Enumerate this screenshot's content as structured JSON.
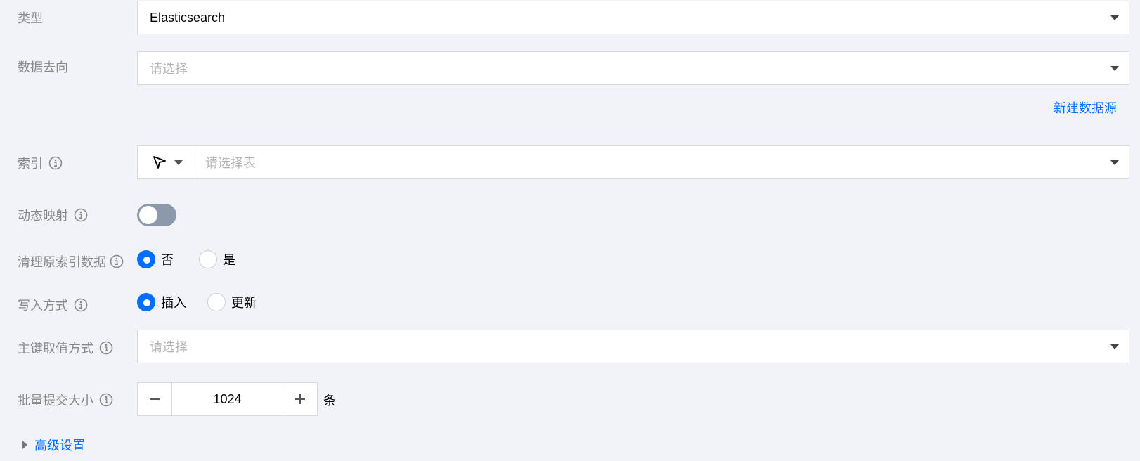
{
  "form": {
    "type": {
      "label": "类型",
      "value": "Elasticsearch"
    },
    "data_destination": {
      "label": "数据去向",
      "placeholder": "请选择"
    },
    "new_datasource_link": "新建数据源",
    "index": {
      "label": "索引",
      "prefix_icon": "cursor-icon",
      "placeholder": "请选择表"
    },
    "dynamic_mapping": {
      "label": "动态映射",
      "enabled": false
    },
    "clear_index_data": {
      "label": "清理原索引数据",
      "options": [
        {
          "label": "否",
          "checked": true
        },
        {
          "label": "是",
          "checked": false
        }
      ]
    },
    "write_mode": {
      "label": "写入方式",
      "options": [
        {
          "label": "插入",
          "checked": true
        },
        {
          "label": "更新",
          "checked": false
        }
      ]
    },
    "primary_key_mode": {
      "label": "主键取值方式",
      "placeholder": "请选择"
    },
    "batch_size": {
      "label": "批量提交大小",
      "value": "1024",
      "unit": "条"
    },
    "advanced_settings": "高级设置"
  },
  "colors": {
    "accent": "#006eff",
    "background": "#f2f3f8",
    "label": "#888888",
    "toggle_off": "#8c99aa"
  }
}
